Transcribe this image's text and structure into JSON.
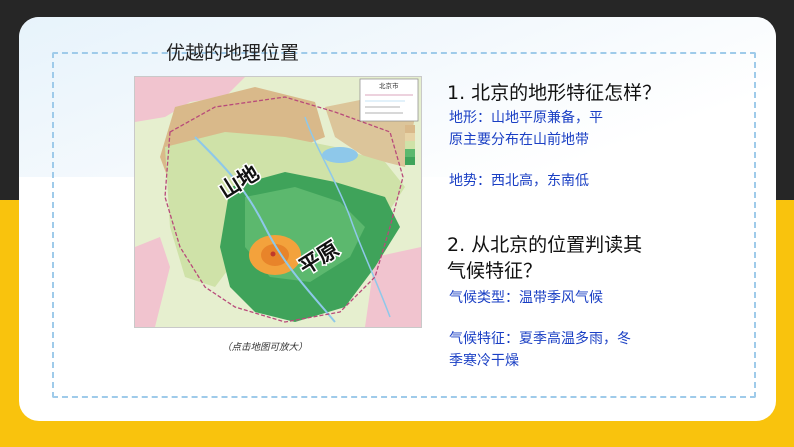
{
  "slide": {
    "title": "优越的地理位置"
  },
  "map": {
    "legend_title": "北京市",
    "label_mountain": "山地",
    "label_plain": "平原",
    "caption": "（点击地图可放大）",
    "colors": {
      "plain_green": "#3fa35a",
      "hills_light": "#cfe2a8",
      "mountain_tan": "#d9b98a",
      "urban_orange": "#f3a23c",
      "water": "#8ec8ea",
      "pink_outside": "#f1c4cf"
    }
  },
  "questions": {
    "q1": "1. 北京的地形特征怎样？",
    "a1_line1": "地形：山地平原兼备，平",
    "a1_line2": "原主要分布在山前地带",
    "a1_terrain": "地势：西北高，东南低",
    "q2_line1": "2. 从北京的位置判读其",
    "q2_line2": "气候特征？",
    "a2_type": "气候类型：温带季风气候",
    "a2_feature_line1": "气候特征：夏季高温多雨，冬",
    "a2_feature_line2": "季寒冷干燥"
  },
  "theme": {
    "dark_band": "#262626",
    "yellow_band": "#f9c30d",
    "answer_blue": "#1a3fc4",
    "border_blue": "#9fcbea"
  }
}
